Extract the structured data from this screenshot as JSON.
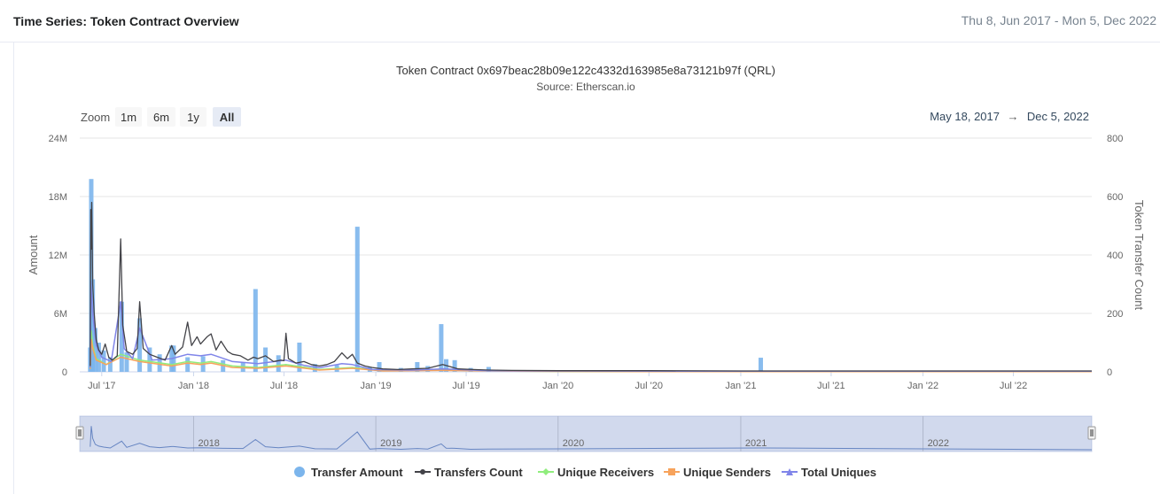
{
  "header": {
    "title": "Time Series: Token Contract Overview",
    "range": "Thu 8, Jun 2017 - Mon 5, Dec 2022"
  },
  "zoom": {
    "label": "Zoom",
    "buttons": [
      "1m",
      "6m",
      "1y",
      "All"
    ],
    "active": "All"
  },
  "range_selector": {
    "from": "May 18, 2017",
    "arrow": "→",
    "to": "Dec 5, 2022"
  },
  "navigator": {
    "year_labels": [
      "2018",
      "2019",
      "2020",
      "2021",
      "2022"
    ]
  },
  "colors": {
    "transfer_amount": "#7cb5ec",
    "transfers_count": "#434348",
    "unique_receivers": "#90ed7d",
    "unique_senders": "#f7a35c",
    "total_uniques": "#8085e9"
  },
  "chart_data": {
    "type": "bar+line",
    "title": "Token Contract 0x697beac28b09e122c4332d163985e8a73121b97f (QRL)",
    "subtitle": "Source: Etherscan.io",
    "x_tick_labels": [
      "Jul '17",
      "Jan '18",
      "Jul '18",
      "Jan '19",
      "Jul '19",
      "Jan '20",
      "Jul '20",
      "Jan '21",
      "Jul '21",
      "Jan '22",
      "Jul '22"
    ],
    "x_range": [
      "2017-05-18",
      "2022-12-05"
    ],
    "y_left": {
      "label": "Amount",
      "ticks": [
        "0",
        "6M",
        "12M",
        "18M",
        "24M"
      ],
      "range": [
        0,
        24000000
      ]
    },
    "y_right": {
      "label": "Token Transfer Count",
      "ticks": [
        "0",
        "200",
        "400",
        "600",
        "800"
      ],
      "range": [
        0,
        800
      ]
    },
    "legend": [
      "Transfer Amount",
      "Transfers Count",
      "Unique Receivers",
      "Unique Senders",
      "Total Uniques"
    ],
    "legend_position": "bottom-center",
    "grid": true,
    "series": [
      {
        "name": "Transfer Amount",
        "axis": "left",
        "type": "column",
        "points": [
          [
            "2017-06-08",
            2500000
          ],
          [
            "2017-06-10",
            19800000
          ],
          [
            "2017-06-13",
            9500000
          ],
          [
            "2017-06-18",
            4500000
          ],
          [
            "2017-06-25",
            3000000
          ],
          [
            "2017-07-05",
            2200000
          ],
          [
            "2017-07-18",
            1500000
          ],
          [
            "2017-08-10",
            7200000
          ],
          [
            "2017-08-20",
            2000000
          ],
          [
            "2017-09-15",
            5500000
          ],
          [
            "2017-10-05",
            2500000
          ],
          [
            "2017-10-25",
            1800000
          ],
          [
            "2017-11-18",
            2700000
          ],
          [
            "2017-11-22",
            2700000
          ],
          [
            "2017-12-20",
            1500000
          ],
          [
            "2018-01-20",
            1600000
          ],
          [
            "2018-03-01",
            1200000
          ],
          [
            "2018-04-10",
            1000000
          ],
          [
            "2018-05-05",
            8500000
          ],
          [
            "2018-05-25",
            2500000
          ],
          [
            "2018-06-20",
            1700000
          ],
          [
            "2018-08-01",
            3000000
          ],
          [
            "2018-09-01",
            800000
          ],
          [
            "2018-10-15",
            700000
          ],
          [
            "2018-11-25",
            14900000
          ],
          [
            "2018-12-20",
            500000
          ],
          [
            "2019-01-08",
            1000000
          ],
          [
            "2019-02-20",
            400000
          ],
          [
            "2019-03-25",
            1000000
          ],
          [
            "2019-04-15",
            600000
          ],
          [
            "2019-05-12",
            4900000
          ],
          [
            "2019-05-22",
            1300000
          ],
          [
            "2019-06-08",
            1200000
          ],
          [
            "2019-07-10",
            400000
          ],
          [
            "2019-08-15",
            500000
          ],
          [
            "2021-02-10",
            1450000
          ]
        ]
      },
      {
        "name": "Transfers Count",
        "axis": "right",
        "type": "line",
        "points": [
          [
            "2017-06-08",
            20
          ],
          [
            "2017-06-09",
            555
          ],
          [
            "2017-06-10",
            420
          ],
          [
            "2017-06-11",
            580
          ],
          [
            "2017-06-13",
            300
          ],
          [
            "2017-06-16",
            200
          ],
          [
            "2017-06-20",
            110
          ],
          [
            "2017-06-25",
            75
          ],
          [
            "2017-07-01",
            60
          ],
          [
            "2017-07-08",
            95
          ],
          [
            "2017-07-15",
            50
          ],
          [
            "2017-07-22",
            40
          ],
          [
            "2017-08-01",
            55
          ],
          [
            "2017-08-08",
            455
          ],
          [
            "2017-08-12",
            160
          ],
          [
            "2017-08-20",
            70
          ],
          [
            "2017-09-01",
            60
          ],
          [
            "2017-09-10",
            80
          ],
          [
            "2017-09-15",
            240
          ],
          [
            "2017-09-22",
            80
          ],
          [
            "2017-10-05",
            60
          ],
          [
            "2017-10-20",
            50
          ],
          [
            "2017-11-05",
            40
          ],
          [
            "2017-11-18",
            90
          ],
          [
            "2017-11-25",
            60
          ],
          [
            "2017-12-10",
            85
          ],
          [
            "2017-12-20",
            170
          ],
          [
            "2017-12-28",
            90
          ],
          [
            "2018-01-08",
            120
          ],
          [
            "2018-01-15",
            95
          ],
          [
            "2018-01-28",
            120
          ],
          [
            "2018-02-05",
            130
          ],
          [
            "2018-02-15",
            75
          ],
          [
            "2018-02-25",
            105
          ],
          [
            "2018-03-10",
            70
          ],
          [
            "2018-03-20",
            60
          ],
          [
            "2018-04-05",
            55
          ],
          [
            "2018-04-20",
            40
          ],
          [
            "2018-05-01",
            50
          ],
          [
            "2018-05-10",
            45
          ],
          [
            "2018-05-25",
            55
          ],
          [
            "2018-06-10",
            35
          ],
          [
            "2018-06-25",
            40
          ],
          [
            "2018-07-01",
            38
          ],
          [
            "2018-07-05",
            132
          ],
          [
            "2018-07-10",
            45
          ],
          [
            "2018-07-25",
            30
          ],
          [
            "2018-08-10",
            35
          ],
          [
            "2018-08-25",
            25
          ],
          [
            "2018-09-10",
            20
          ],
          [
            "2018-09-25",
            25
          ],
          [
            "2018-10-10",
            35
          ],
          [
            "2018-10-25",
            65
          ],
          [
            "2018-11-05",
            45
          ],
          [
            "2018-11-15",
            60
          ],
          [
            "2018-11-25",
            30
          ],
          [
            "2018-12-10",
            20
          ],
          [
            "2018-12-25",
            15
          ],
          [
            "2019-01-15",
            10
          ],
          [
            "2019-02-15",
            8
          ],
          [
            "2019-03-15",
            10
          ],
          [
            "2019-04-15",
            12
          ],
          [
            "2019-05-15",
            25
          ],
          [
            "2019-06-15",
            10
          ],
          [
            "2019-07-15",
            8
          ],
          [
            "2019-08-15",
            6
          ],
          [
            "2019-10-01",
            5
          ],
          [
            "2020-01-01",
            4
          ],
          [
            "2020-07-01",
            4
          ],
          [
            "2021-01-01",
            3
          ],
          [
            "2021-07-01",
            3
          ],
          [
            "2022-01-01",
            3
          ],
          [
            "2022-07-01",
            3
          ],
          [
            "2022-12-05",
            3
          ]
        ]
      },
      {
        "name": "Unique Receivers",
        "axis": "right",
        "type": "line",
        "points": [
          [
            "2017-06-08",
            10
          ],
          [
            "2017-06-10",
            140
          ],
          [
            "2017-06-13",
            90
          ],
          [
            "2017-06-20",
            45
          ],
          [
            "2017-07-10",
            25
          ],
          [
            "2017-08-08",
            60
          ],
          [
            "2017-09-15",
            40
          ],
          [
            "2017-11-18",
            25
          ],
          [
            "2017-12-20",
            35
          ],
          [
            "2018-01-15",
            30
          ],
          [
            "2018-02-05",
            35
          ],
          [
            "2018-03-20",
            20
          ],
          [
            "2018-05-10",
            15
          ],
          [
            "2018-07-05",
            25
          ],
          [
            "2018-09-10",
            8
          ],
          [
            "2018-11-15",
            15
          ],
          [
            "2019-01-15",
            4
          ],
          [
            "2019-05-15",
            6
          ],
          [
            "2019-10-01",
            2
          ],
          [
            "2020-07-01",
            1
          ],
          [
            "2021-07-01",
            1
          ],
          [
            "2022-12-05",
            1
          ]
        ]
      },
      {
        "name": "Unique Senders",
        "axis": "right",
        "type": "line",
        "points": [
          [
            "2017-06-08",
            10
          ],
          [
            "2017-06-10",
            110
          ],
          [
            "2017-06-13",
            80
          ],
          [
            "2017-06-20",
            40
          ],
          [
            "2017-07-10",
            25
          ],
          [
            "2017-08-08",
            50
          ],
          [
            "2017-09-15",
            35
          ],
          [
            "2017-11-18",
            20
          ],
          [
            "2017-12-20",
            30
          ],
          [
            "2018-01-15",
            25
          ],
          [
            "2018-02-05",
            30
          ],
          [
            "2018-03-20",
            15
          ],
          [
            "2018-05-10",
            12
          ],
          [
            "2018-07-05",
            20
          ],
          [
            "2018-09-10",
            6
          ],
          [
            "2018-11-15",
            12
          ],
          [
            "2019-01-15",
            3
          ],
          [
            "2019-05-15",
            5
          ],
          [
            "2019-10-01",
            2
          ],
          [
            "2020-07-01",
            1
          ],
          [
            "2021-07-01",
            1
          ],
          [
            "2022-12-05",
            1
          ]
        ]
      },
      {
        "name": "Total Uniques",
        "axis": "right",
        "type": "line",
        "points": [
          [
            "2017-06-08",
            15
          ],
          [
            "2017-06-09",
            310
          ],
          [
            "2017-06-11",
            250
          ],
          [
            "2017-06-13",
            200
          ],
          [
            "2017-06-20",
            90
          ],
          [
            "2017-07-01",
            50
          ],
          [
            "2017-07-20",
            35
          ],
          [
            "2017-08-08",
            240
          ],
          [
            "2017-08-15",
            80
          ],
          [
            "2017-09-01",
            45
          ],
          [
            "2017-09-15",
            150
          ],
          [
            "2017-10-10",
            40
          ],
          [
            "2017-11-18",
            45
          ],
          [
            "2017-12-20",
            60
          ],
          [
            "2018-01-15",
            55
          ],
          [
            "2018-02-05",
            60
          ],
          [
            "2018-03-20",
            35
          ],
          [
            "2018-05-10",
            28
          ],
          [
            "2018-07-05",
            40
          ],
          [
            "2018-08-10",
            22
          ],
          [
            "2018-09-10",
            14
          ],
          [
            "2018-10-25",
            28
          ],
          [
            "2018-11-15",
            25
          ],
          [
            "2018-12-25",
            8
          ],
          [
            "2019-03-15",
            6
          ],
          [
            "2019-05-15",
            10
          ],
          [
            "2019-08-15",
            4
          ],
          [
            "2020-01-01",
            3
          ],
          [
            "2021-01-01",
            2
          ],
          [
            "2022-01-01",
            2
          ],
          [
            "2022-12-05",
            2
          ]
        ]
      }
    ]
  }
}
